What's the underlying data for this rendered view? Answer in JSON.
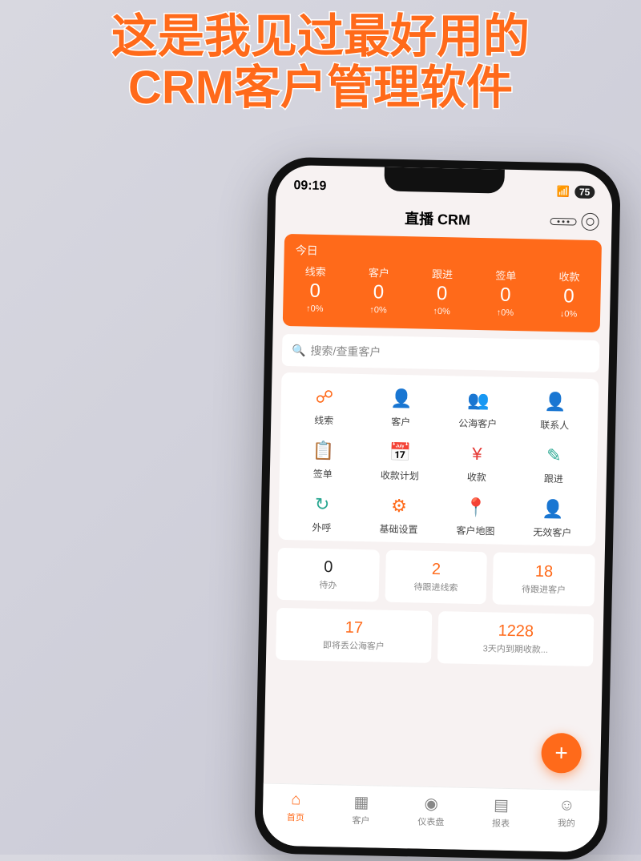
{
  "headline": {
    "line1": "这是我见过最好用的",
    "line2": "CRM客户管理软件"
  },
  "status": {
    "time": "09:19",
    "battery": "75"
  },
  "title": "直播 CRM",
  "hero": {
    "today": "今日",
    "cells": [
      {
        "label": "线索",
        "value": "0",
        "pct": "↑0%"
      },
      {
        "label": "客户",
        "value": "0",
        "pct": "↑0%"
      },
      {
        "label": "跟进",
        "value": "0",
        "pct": "↑0%"
      },
      {
        "label": "签单",
        "value": "0",
        "pct": "↑0%"
      },
      {
        "label": "收款",
        "value": "0",
        "pct": "↓0%"
      }
    ]
  },
  "search": {
    "placeholder": "搜索/查重客户"
  },
  "grid": [
    {
      "label": "线索",
      "icon": "lead-icon",
      "color": "ic-orange",
      "glyph": "☍"
    },
    {
      "label": "客户",
      "icon": "customer-icon",
      "color": "ic-orange",
      "glyph": "👤"
    },
    {
      "label": "公海客户",
      "icon": "public-customer-icon",
      "color": "ic-blue",
      "glyph": "👥"
    },
    {
      "label": "联系人",
      "icon": "contact-icon",
      "color": "ic-blue",
      "glyph": "👤"
    },
    {
      "label": "签单",
      "icon": "sign-icon",
      "color": "ic-orange",
      "glyph": "📋"
    },
    {
      "label": "收款计划",
      "icon": "plan-icon",
      "color": "ic-blue",
      "glyph": "📅"
    },
    {
      "label": "收款",
      "icon": "payment-icon",
      "color": "ic-red",
      "glyph": "¥"
    },
    {
      "label": "跟进",
      "icon": "followup-icon",
      "color": "ic-teal",
      "glyph": "✎"
    },
    {
      "label": "外呼",
      "icon": "call-icon",
      "color": "ic-teal",
      "glyph": "↻"
    },
    {
      "label": "基础设置",
      "icon": "settings-icon",
      "color": "ic-orange",
      "glyph": "⚙"
    },
    {
      "label": "客户地图",
      "icon": "map-icon",
      "color": "ic-orange",
      "glyph": "📍"
    },
    {
      "label": "无效客户",
      "icon": "invalid-icon",
      "color": "ic-grey",
      "glyph": "👤"
    }
  ],
  "cards": [
    {
      "num": "0",
      "label": "待办",
      "hot": false
    },
    {
      "num": "2",
      "label": "待跟进线索",
      "hot": true
    },
    {
      "num": "18",
      "label": "待跟进客户",
      "hot": true
    },
    {
      "num": "17",
      "label": "即将丢公海客户",
      "hot": true
    },
    {
      "num": "1228",
      "label": "3天内到期收款...",
      "hot": true
    }
  ],
  "tabs": [
    {
      "label": "首页",
      "icon": "home-icon",
      "glyph": "⌂",
      "active": true
    },
    {
      "label": "客户",
      "icon": "customers-tab-icon",
      "glyph": "▦",
      "active": false
    },
    {
      "label": "仪表盘",
      "icon": "dashboard-icon",
      "glyph": "◉",
      "active": false
    },
    {
      "label": "报表",
      "icon": "report-icon",
      "glyph": "▤",
      "active": false
    },
    {
      "label": "我的",
      "icon": "profile-icon",
      "glyph": "☺",
      "active": false
    }
  ],
  "fab": "+"
}
